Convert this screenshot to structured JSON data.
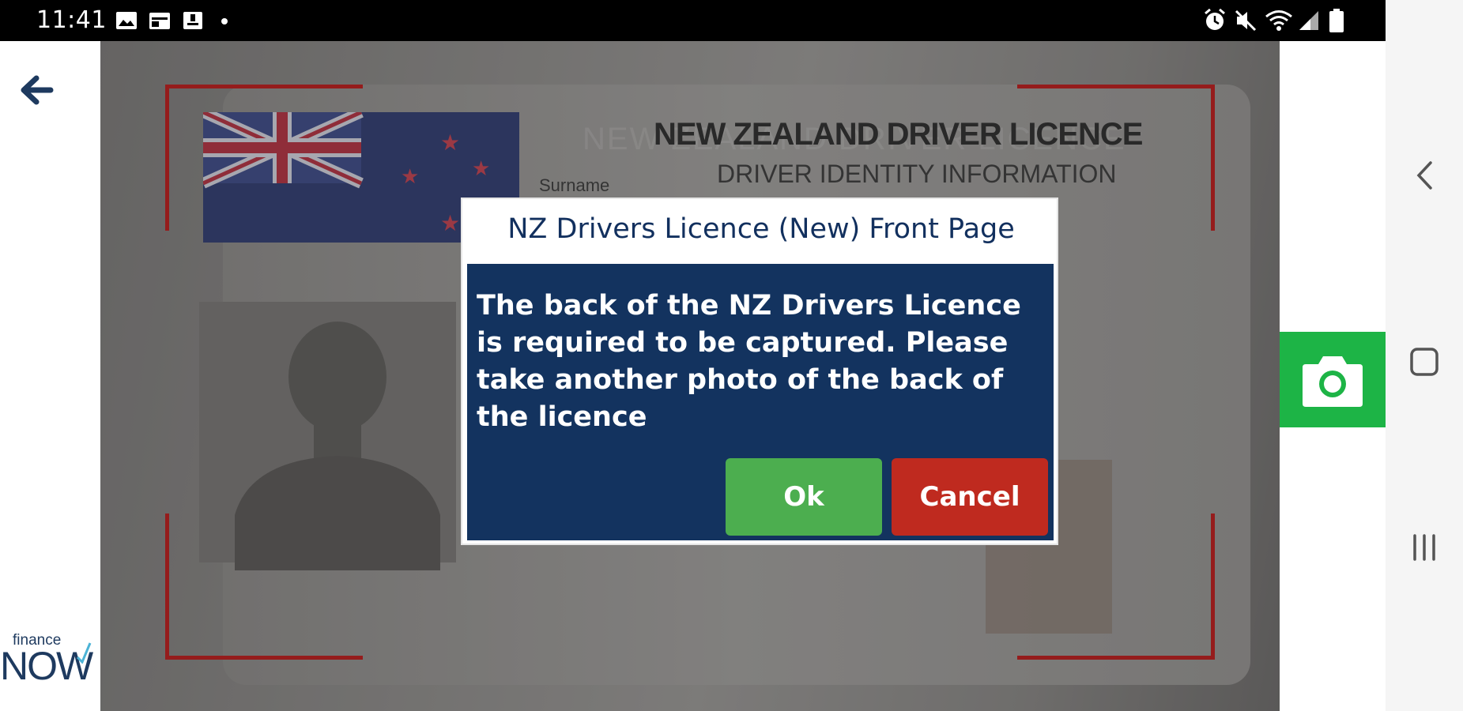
{
  "status_bar": {
    "time": "11:41",
    "left_icons": [
      "gallery-icon",
      "calendar-icon",
      "download-icon",
      "dot-icon"
    ],
    "right_icons": [
      "alarm-icon",
      "mute-icon",
      "wifi-icon",
      "signal-icon",
      "battery-icon"
    ]
  },
  "left_panel": {
    "back_icon": "arrow-left-icon",
    "brand_small": "finance",
    "brand_large": "NOW"
  },
  "preview": {
    "card_title": "NEW ZEALAND DRIVER LICENCE",
    "card_subtitle": "DRIVER IDENTITY INFORMATION",
    "card_field": "Surname",
    "card_ghost": "NEW ZEALAND DRIVER LICENCE"
  },
  "dialog": {
    "title": "NZ Drivers Licence (New) Front Page",
    "message": "The back of the NZ Drivers Licence is required to be captured. Please take another photo of the back of the licence",
    "ok_label": "Ok",
    "cancel_label": "Cancel"
  },
  "right_panel": {
    "capture_icon": "camera-icon",
    "capture_color": "#1db446"
  },
  "nav_bar": {
    "items": [
      "back-nav-icon",
      "home-nav-icon",
      "recents-nav-icon"
    ]
  },
  "colors": {
    "dialog_title": "#12305e",
    "dialog_body": "#13335f",
    "ok": "#4cae4f",
    "cancel": "#bf2a1f",
    "frame_bracket": "#c01818"
  }
}
